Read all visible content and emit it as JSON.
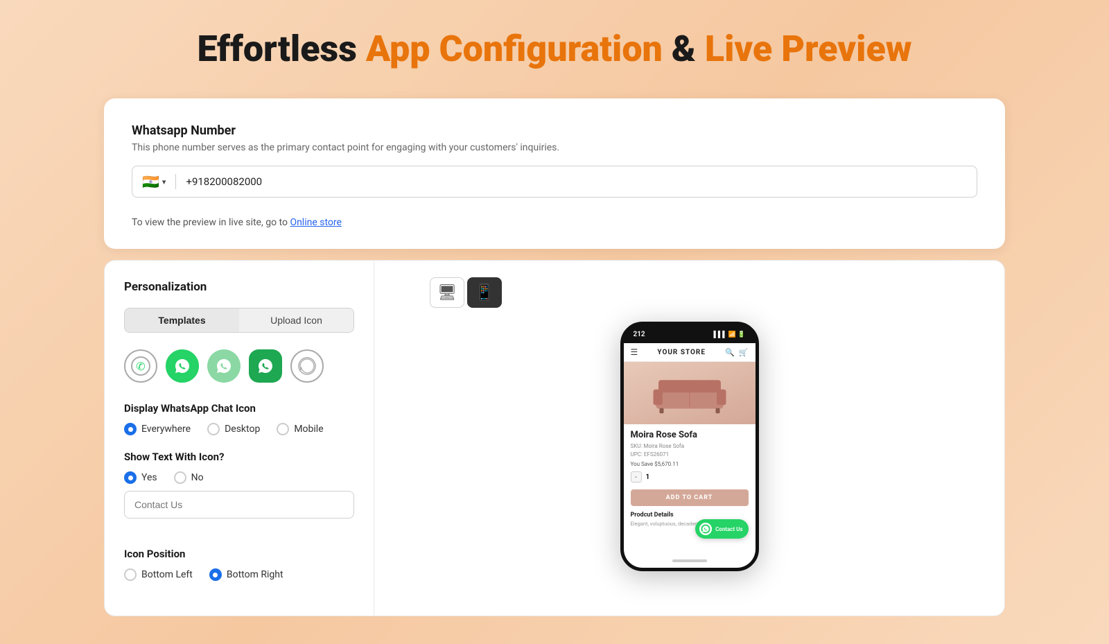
{
  "page": {
    "title_part1": "Effortless",
    "title_part2": "App Configuration",
    "title_part3": "&",
    "title_part4": "Live Preview"
  },
  "whatsapp_section": {
    "title": "Whatsapp Number",
    "description": "This phone number serves as the primary contact point for engaging with your customers' inquiries.",
    "flag_emoji": "🇮🇳",
    "phone_number": "+918200082000",
    "preview_text": "To view the preview in live site, go to",
    "preview_link_label": "Online store"
  },
  "personalization": {
    "heading": "Personalization",
    "tab_templates": "Templates",
    "tab_upload": "Upload Icon",
    "display_title": "Display WhatsApp Chat Icon",
    "display_options": [
      {
        "label": "Everywhere",
        "selected": true
      },
      {
        "label": "Desktop",
        "selected": false
      },
      {
        "label": "Mobile",
        "selected": false
      }
    ],
    "show_text_title": "Show Text With Icon?",
    "show_text_options": [
      {
        "label": "Yes",
        "selected": true
      },
      {
        "label": "No",
        "selected": false
      }
    ],
    "contact_text_placeholder": "Contact Us",
    "icon_position_title": "Icon Position",
    "position_options": [
      {
        "label": "Bottom Left",
        "selected": false
      },
      {
        "label": "Bottom Right",
        "selected": true
      }
    ]
  },
  "preview": {
    "device_desktop_icon": "🖥",
    "device_mobile_icon": "📱",
    "store_name": "YOUR STORE",
    "product_name": "Moira Rose Sofa",
    "product_sku": "SKU: Moira Rose Sofa",
    "product_upc": "UPC: EFS26071",
    "product_price": "You Save $5,670.11",
    "add_to_cart_label": "ADD TO CART",
    "product_details_title": "Prodcut Details",
    "product_details_desc": "Elegant, voluptuous, decadent...",
    "wa_float_text": "Contact Us",
    "notch_time": "212",
    "notch_signal": "▌▌▌",
    "qty_minus": "-",
    "qty_val": "1",
    "qty_plus": "+"
  }
}
